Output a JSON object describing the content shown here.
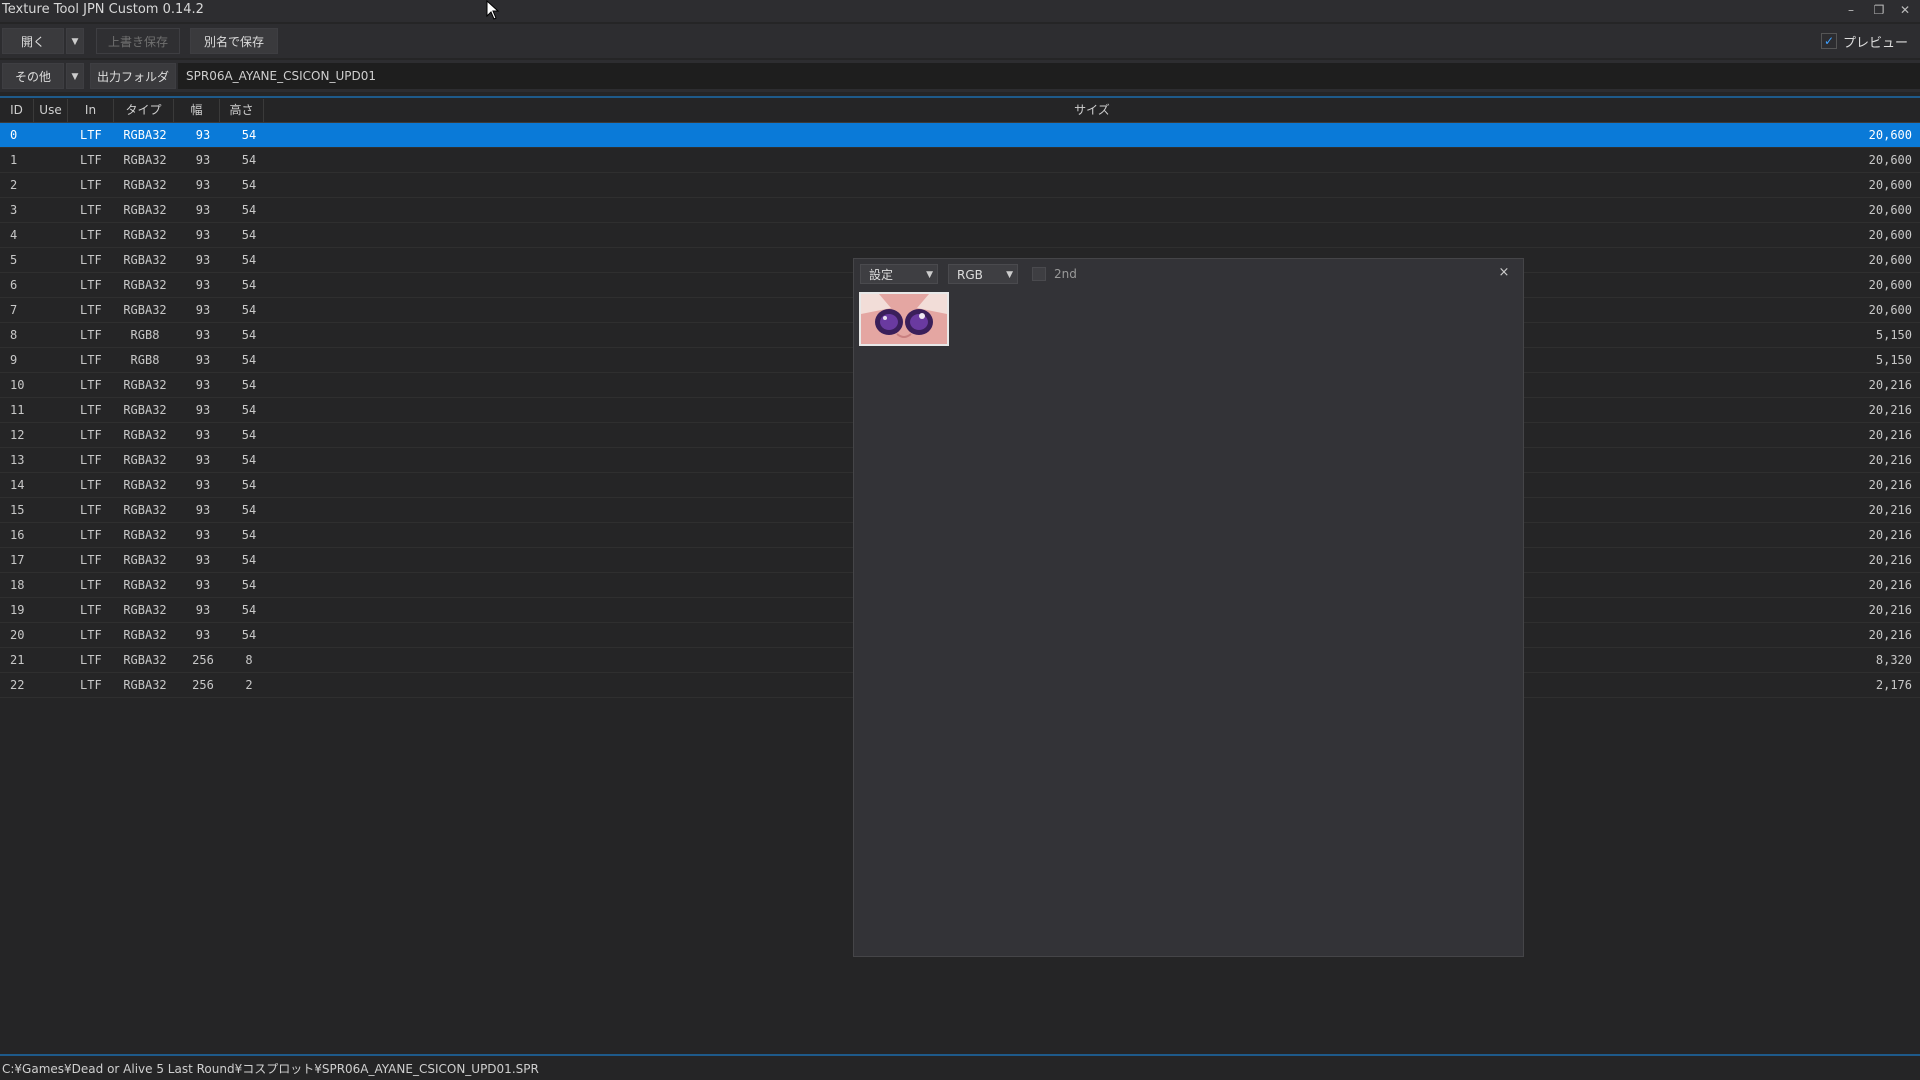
{
  "window": {
    "title": "Texture Tool JPN Custom 0.14.2",
    "minimize_glyph": "–",
    "restore_glyph": "❐",
    "close_glyph": "✕"
  },
  "toolbar": {
    "open_label": "開く",
    "overwrite_save_label": "上書き保存",
    "save_as_label": "別名で保存",
    "preview_label": "プレビュー",
    "preview_checked": true
  },
  "toolbar2": {
    "other_label": "その他",
    "output_folder_label": "出力フォルダ",
    "output_folder_value": "SPR06A_AYANE_CSICON_UPD01"
  },
  "table": {
    "columns": {
      "id": "ID",
      "use": "Use",
      "in": "In",
      "type": "タイプ",
      "width": "幅",
      "height": "高さ",
      "size": "サイズ"
    },
    "rows": [
      {
        "id": "0",
        "in": "LTF",
        "type": "RGBA32",
        "w": "93",
        "h": "54",
        "size": "20,600"
      },
      {
        "id": "1",
        "in": "LTF",
        "type": "RGBA32",
        "w": "93",
        "h": "54",
        "size": "20,600"
      },
      {
        "id": "2",
        "in": "LTF",
        "type": "RGBA32",
        "w": "93",
        "h": "54",
        "size": "20,600"
      },
      {
        "id": "3",
        "in": "LTF",
        "type": "RGBA32",
        "w": "93",
        "h": "54",
        "size": "20,600"
      },
      {
        "id": "4",
        "in": "LTF",
        "type": "RGBA32",
        "w": "93",
        "h": "54",
        "size": "20,600"
      },
      {
        "id": "5",
        "in": "LTF",
        "type": "RGBA32",
        "w": "93",
        "h": "54",
        "size": "20,600"
      },
      {
        "id": "6",
        "in": "LTF",
        "type": "RGBA32",
        "w": "93",
        "h": "54",
        "size": "20,600"
      },
      {
        "id": "7",
        "in": "LTF",
        "type": "RGBA32",
        "w": "93",
        "h": "54",
        "size": "20,600"
      },
      {
        "id": "8",
        "in": "LTF",
        "type": "RGB8",
        "w": "93",
        "h": "54",
        "size": "5,150"
      },
      {
        "id": "9",
        "in": "LTF",
        "type": "RGB8",
        "w": "93",
        "h": "54",
        "size": "5,150"
      },
      {
        "id": "10",
        "in": "LTF",
        "type": "RGBA32",
        "w": "93",
        "h": "54",
        "size": "20,216"
      },
      {
        "id": "11",
        "in": "LTF",
        "type": "RGBA32",
        "w": "93",
        "h": "54",
        "size": "20,216"
      },
      {
        "id": "12",
        "in": "LTF",
        "type": "RGBA32",
        "w": "93",
        "h": "54",
        "size": "20,216"
      },
      {
        "id": "13",
        "in": "LTF",
        "type": "RGBA32",
        "w": "93",
        "h": "54",
        "size": "20,216"
      },
      {
        "id": "14",
        "in": "LTF",
        "type": "RGBA32",
        "w": "93",
        "h": "54",
        "size": "20,216"
      },
      {
        "id": "15",
        "in": "LTF",
        "type": "RGBA32",
        "w": "93",
        "h": "54",
        "size": "20,216"
      },
      {
        "id": "16",
        "in": "LTF",
        "type": "RGBA32",
        "w": "93",
        "h": "54",
        "size": "20,216"
      },
      {
        "id": "17",
        "in": "LTF",
        "type": "RGBA32",
        "w": "93",
        "h": "54",
        "size": "20,216"
      },
      {
        "id": "18",
        "in": "LTF",
        "type": "RGBA32",
        "w": "93",
        "h": "54",
        "size": "20,216"
      },
      {
        "id": "19",
        "in": "LTF",
        "type": "RGBA32",
        "w": "93",
        "h": "54",
        "size": "20,216"
      },
      {
        "id": "20",
        "in": "LTF",
        "type": "RGBA32",
        "w": "93",
        "h": "54",
        "size": "20,216"
      },
      {
        "id": "21",
        "in": "LTF",
        "type": "RGBA32",
        "w": "256",
        "h": "8",
        "size": "8,320"
      },
      {
        "id": "22",
        "in": "LTF",
        "type": "RGBA32",
        "w": "256",
        "h": "2",
        "size": "2,176"
      }
    ],
    "selected_row": "0"
  },
  "preview_panel": {
    "settings_label": "設定",
    "channel_label": "RGB",
    "second_label": "2nd",
    "close_glyph": "×"
  },
  "statusbar": {
    "path": "C:¥Games¥Dead or Alive 5 Last Round¥コスプロット¥SPR06A_AYANE_CSICON_UPD01.SPR"
  },
  "colors": {
    "background": "#252526",
    "toolbar": "#2d2d30",
    "selection": "#0a7ad8",
    "accent": "#1e5a8a"
  }
}
